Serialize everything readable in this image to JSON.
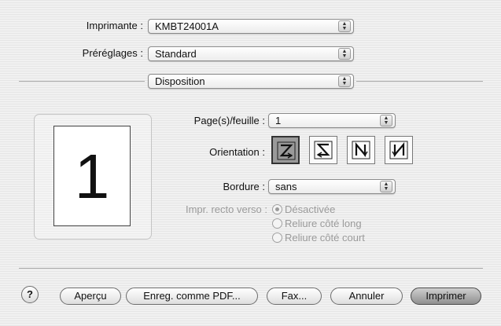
{
  "printer": {
    "label": "Imprimante :",
    "value": "KMBT24001A"
  },
  "presets": {
    "label": "Préréglages :",
    "value": "Standard"
  },
  "pane": {
    "value": "Disposition"
  },
  "preview": {
    "page_number": "1"
  },
  "layout": {
    "pages_per_sheet": {
      "label": "Page(s)/feuille :",
      "value": "1"
    },
    "orientation": {
      "label": "Orientation :",
      "selected_index": 0,
      "options": [
        "z-orientation-icon",
        "reverse-z-orientation-icon",
        "n-orientation-icon",
        "reverse-n-orientation-icon"
      ]
    },
    "border": {
      "label": "Bordure :",
      "value": "sans"
    },
    "duplex": {
      "label": "Impr. recto verso :",
      "options": [
        "Désactivée",
        "Reliure côté long",
        "Reliure côté court"
      ],
      "selected_index": 0
    }
  },
  "buttons": {
    "help": "?",
    "preview": "Aperçu",
    "save_pdf": "Enreg. comme PDF...",
    "fax": "Fax...",
    "cancel": "Annuler",
    "print": "Imprimer"
  }
}
